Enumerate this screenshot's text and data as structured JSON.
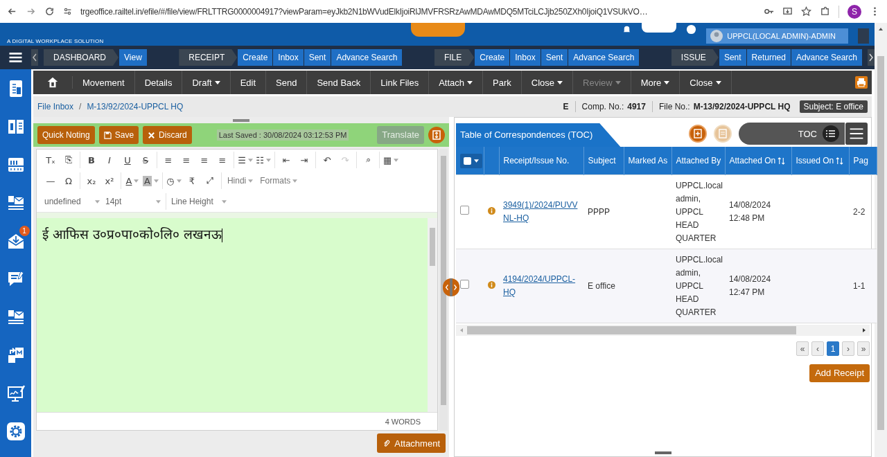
{
  "browser": {
    "url": "trgeoffice.railtel.in/efile/#/file/view/FRLTTRG0000004917?viewParam=eyJkb2N1bWVudElkIjoiRlJMVFRSRzAwMDAwMDQ5MTciLCJjb250ZXh0IjoiQ1VSUkVO…",
    "profile": "S"
  },
  "header": {
    "tagline": "A DIGITAL WORKPLACE SOLUTION",
    "user": "UPPCL(LOCAL ADMIN)-ADMIN"
  },
  "nav": [
    {
      "label": "DASHBOARD",
      "links": [
        "View"
      ]
    },
    {
      "label": "RECEIPT",
      "links": [
        "Create",
        "Inbox",
        "Sent",
        "Advance Search"
      ]
    },
    {
      "label": "FILE",
      "links": [
        "Create",
        "Inbox",
        "Sent",
        "Advance Search"
      ]
    },
    {
      "label": "ISSUE",
      "links": [
        "Sent",
        "Returned",
        "Advance Search"
      ]
    }
  ],
  "toolbar": [
    {
      "label": "Movement",
      "dropdown": false,
      "disabled": false
    },
    {
      "label": "Details",
      "dropdown": false,
      "disabled": false
    },
    {
      "label": "Draft",
      "dropdown": true,
      "disabled": false
    },
    {
      "label": "Edit",
      "dropdown": false,
      "disabled": false
    },
    {
      "label": "Send",
      "dropdown": false,
      "disabled": false
    },
    {
      "label": "Send Back",
      "dropdown": false,
      "disabled": false
    },
    {
      "label": "Link Files",
      "dropdown": false,
      "disabled": false
    },
    {
      "label": "Attach",
      "dropdown": true,
      "disabled": false
    },
    {
      "label": "Park",
      "dropdown": false,
      "disabled": false
    },
    {
      "label": "Close",
      "dropdown": true,
      "disabled": false
    },
    {
      "label": "Review",
      "dropdown": true,
      "disabled": true
    },
    {
      "label": "More",
      "dropdown": true,
      "disabled": false
    },
    {
      "label": "Close",
      "dropdown": true,
      "disabled": false
    }
  ],
  "breadcrumb": {
    "items": [
      "File Inbox",
      "M-13/92/2024-UPPCL HQ"
    ],
    "separator": "/"
  },
  "file_info": {
    "type": "E",
    "comp_label": "Comp. No.:",
    "comp_no": "4917",
    "file_label": "File No.:",
    "file_no": "M-13/92/2024-UPPCL HQ",
    "subject_label": "Subject:",
    "subject": "E office"
  },
  "sidebar": {
    "badge": "1"
  },
  "note": {
    "actions": [
      {
        "label": "Quick Noting",
        "kind": "plain"
      },
      {
        "label": "Save",
        "kind": "save"
      },
      {
        "label": "Discard",
        "kind": "discard"
      }
    ],
    "last_saved": "Last Saved : 30/08/2024 03:12:53 PM",
    "translate": "Translate",
    "toolbar_rows": [
      [
        [
          {
            "kind": "icon",
            "label": "Tₓ",
            "disabled": false
          },
          {
            "kind": "icon",
            "label": "⎘",
            "disabled": false
          }
        ],
        [
          {
            "kind": "bold",
            "label": "B",
            "disabled": false
          },
          {
            "kind": "italic",
            "label": "I",
            "disabled": false
          },
          {
            "kind": "underline",
            "label": "U",
            "disabled": false
          },
          {
            "kind": "strike",
            "label": "S",
            "disabled": false
          }
        ],
        [
          {
            "kind": "icon",
            "label": "≡",
            "disabled": false
          },
          {
            "kind": "icon",
            "label": "≡",
            "disabled": false
          },
          {
            "kind": "icon",
            "label": "≡",
            "disabled": false
          },
          {
            "kind": "icon",
            "label": "≡",
            "disabled": false
          }
        ],
        [
          {
            "kind": "icon",
            "label": "☰",
            "dropdown": true,
            "disabled": false
          },
          {
            "kind": "icon",
            "label": "☷",
            "dropdown": true,
            "disabled": false
          }
        ],
        [
          {
            "kind": "icon",
            "label": "⇤",
            "disabled": false
          },
          {
            "kind": "icon",
            "label": "⇥",
            "disabled": false
          }
        ],
        [
          {
            "kind": "icon",
            "label": "↶",
            "disabled": false
          },
          {
            "kind": "icon",
            "label": "↷",
            "disabled": true
          }
        ],
        [
          {
            "kind": "icon",
            "label": "⌕",
            "disabled": false
          }
        ],
        [
          {
            "kind": "icon",
            "label": "▦",
            "dropdown": true,
            "disabled": false
          }
        ]
      ],
      [
        [
          {
            "kind": "icon",
            "label": "—",
            "disabled": false
          },
          {
            "kind": "icon",
            "label": "Ω",
            "disabled": false
          }
        ],
        [
          {
            "kind": "icon",
            "label": "x₂",
            "disabled": false
          },
          {
            "kind": "icon",
            "label": "x²",
            "disabled": false
          }
        ],
        [
          {
            "kind": "underline",
            "label": "A",
            "dropdown": true,
            "disabled": false
          },
          {
            "kind": "highlight",
            "label": "A",
            "dropdown": true,
            "disabled": false
          }
        ],
        [
          {
            "kind": "icon",
            "label": "◷",
            "dropdown": true,
            "disabled": false
          },
          {
            "kind": "icon",
            "label": "₹",
            "disabled": false
          },
          {
            "kind": "icon",
            "label": "⤢",
            "disabled": false
          }
        ],
        [
          {
            "kind": "text",
            "label": "Hindi",
            "dropdown": true,
            "disabled": false
          },
          {
            "kind": "text",
            "label": "Formats",
            "dropdown": true,
            "disabled": false
          }
        ]
      ],
      [
        [
          {
            "kind": "select",
            "label": "undefined",
            "dropdown": true,
            "disabled": false
          },
          {
            "kind": "select",
            "label": "14pt",
            "dropdown": true,
            "disabled": false
          }
        ],
        [
          {
            "kind": "select",
            "label": "Line Height",
            "dropdown": true,
            "disabled": false
          }
        ]
      ]
    ],
    "content": "ई आफिस उ०प्र०पा०को०लि० लखनऊ",
    "word_count": "4 WORDS",
    "attachment": "Attachment"
  },
  "toc": {
    "title": "Table of Correspondences (TOC)",
    "view_label": "TOC",
    "columns": [
      {
        "kind": "select",
        "checked": false
      },
      {
        "kind": "blank"
      },
      {
        "kind": "text",
        "label": "Receipt/Issue No.",
        "sortable": false
      },
      {
        "kind": "text",
        "label": "Subject",
        "sortable": false
      },
      {
        "kind": "text",
        "label": "Marked As",
        "sortable": false
      },
      {
        "kind": "text",
        "label": "Attached By",
        "sortable": false
      },
      {
        "kind": "text",
        "label": "Attached On",
        "sortable": true
      },
      {
        "kind": "text",
        "label": "Issued On",
        "sortable": true
      },
      {
        "kind": "text",
        "label": "Pag",
        "sortable": false
      }
    ],
    "rows": [
      {
        "checked": false,
        "receipt_no": "3949(1)/2024/PUVVNL-HQ",
        "subject": "PPPP",
        "attached_by": "UPPCL.local admin, UPPCL HEAD QUARTER",
        "attached_on": "14/08/2024 12:48 PM",
        "pages": "2-2"
      },
      {
        "checked": false,
        "receipt_no": "4194/2024/UPPCL-HQ",
        "subject": "E office",
        "attached_by": "UPPCL.local admin, UPPCL HEAD QUARTER",
        "attached_on": "14/08/2024 12:47 PM",
        "pages": "1-1"
      }
    ],
    "pages": [
      {
        "label": "«",
        "selected": false
      },
      {
        "label": "‹",
        "selected": false
      },
      {
        "label": "1",
        "selected": true
      },
      {
        "label": "›",
        "selected": false
      },
      {
        "label": "»",
        "selected": false
      }
    ],
    "add_receipt": "Add Receipt"
  }
}
